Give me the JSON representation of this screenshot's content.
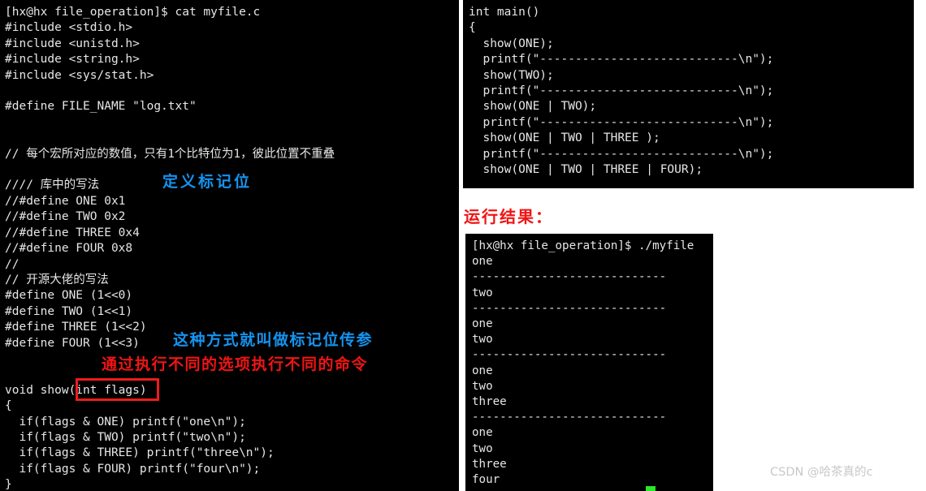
{
  "left_terminal": {
    "name": "source-listing-terminal",
    "prompt": "[hx@hx file_operation]$ cat myfile.c",
    "lines": [
      "[hx@hx file_operation]$ cat myfile.c",
      "#include <stdio.h>",
      "#include <unistd.h>",
      "#include <string.h>",
      "#include <sys/stat.h>",
      "",
      "#define FILE_NAME \"log.txt\"",
      "",
      "",
      "// 每个宏所对应的数值，只有1个比特位为1，彼此位置不重叠",
      "",
      "//// 库中的写法",
      "//#define ONE 0x1",
      "//#define TWO 0x2",
      "//#define THREE 0x4",
      "//#define FOUR 0x8",
      "//",
      "// 开源大佬的写法",
      "#define ONE (1<<0)",
      "#define TWO (1<<1)",
      "#define THREE (1<<2)",
      "#define FOUR (1<<3)",
      "",
      "",
      "void show(int flags)",
      "{",
      "  if(flags & ONE) printf(\"one\\n\");",
      "  if(flags & TWO) printf(\"two\\n\");",
      "  if(flags & THREE) printf(\"three\\n\");",
      "  if(flags & FOUR) printf(\"four\\n\");",
      "}"
    ]
  },
  "main_terminal": {
    "name": "main-function-terminal",
    "lines": [
      "int main()",
      "{",
      "  show(ONE);",
      "  printf(\"----------------------------\\n\");",
      "  show(TWO);",
      "  printf(\"----------------------------\\n\");",
      "  show(ONE | TWO);",
      "  printf(\"----------------------------\\n\");",
      "  show(ONE | TWO | THREE );",
      "  printf(\"----------------------------\\n\");",
      "  show(ONE | TWO | THREE | FOUR);"
    ]
  },
  "output_terminal": {
    "name": "program-output-terminal",
    "lines": [
      "[hx@hx file_operation]$ ./myfile",
      "one",
      "----------------------------",
      "two",
      "----------------------------",
      "one",
      "two",
      "----------------------------",
      "one",
      "two",
      "three",
      "----------------------------",
      "one",
      "two",
      "three",
      "four"
    ]
  },
  "annotations": {
    "define_flag_bits": "定义标记位",
    "flag_bit_passing": "这种方式就叫做标记位传参",
    "different_options": "通过执行不同的选项执行不同的命令",
    "run_result": "运行结果："
  },
  "colors": {
    "annotation_blue": "#1593ef",
    "annotation_red": "#f01414",
    "highlight_box_border": "#ef1b1b",
    "cursor_green": "#2ae82a",
    "terminal_background": "#000000",
    "terminal_text": "#e6e6e6",
    "watermark_text": "#c8c8c8"
  },
  "watermark": {
    "text": "CSDN @哈茶真的c"
  }
}
